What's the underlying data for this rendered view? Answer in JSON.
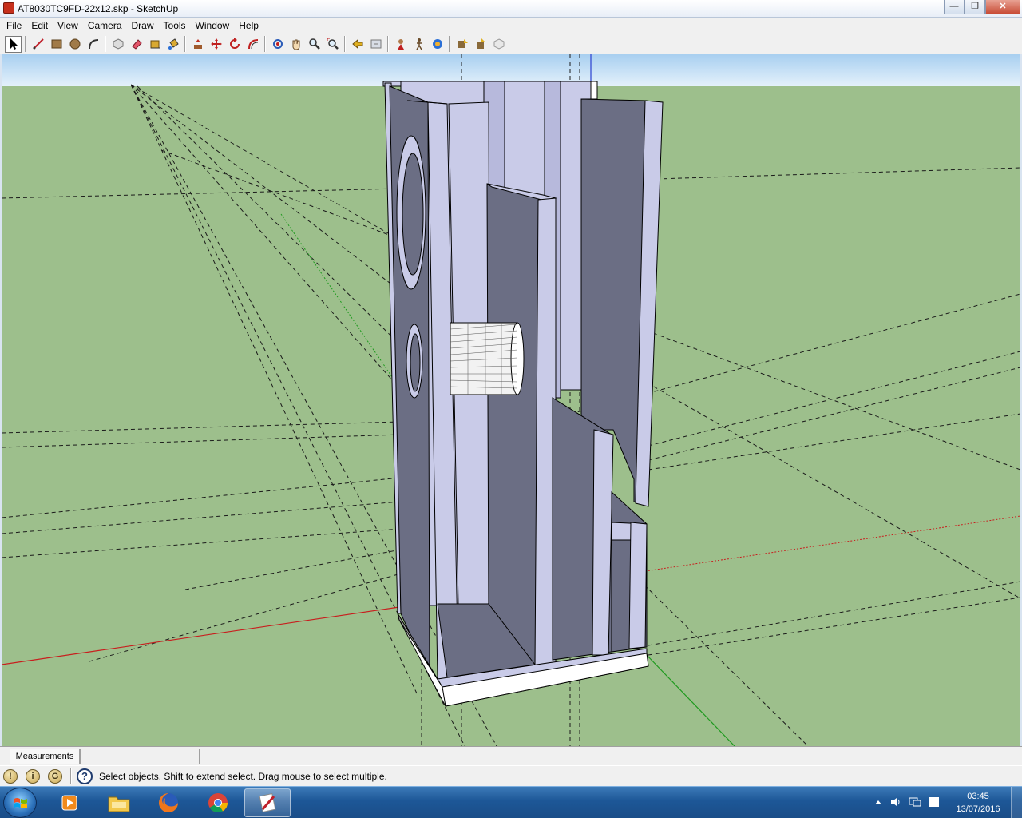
{
  "window": {
    "title": "AT8030TC9FD-22x12.skp - SketchUp",
    "minimize_label": "—",
    "maximize_label": "❐",
    "close_label": "✕"
  },
  "menu": {
    "items": [
      "File",
      "Edit",
      "View",
      "Camera",
      "Draw",
      "Tools",
      "Window",
      "Help"
    ]
  },
  "toolbar": {
    "tools": [
      "select-icon",
      "line-icon",
      "rectangle-icon",
      "circle-icon",
      "arc-icon",
      "make-component-icon",
      "eraser-icon",
      "tape-measure-icon",
      "paint-bucket-icon",
      "push-pull-icon",
      "move-icon",
      "rotate-icon",
      "offset-icon",
      "orbit-icon",
      "pan-icon",
      "zoom-icon",
      "zoom-extents-icon",
      "previous-view-icon",
      "next-view-icon",
      "position-camera-icon",
      "walk-icon",
      "look-around-icon",
      "get-models-icon",
      "share-model-icon",
      "component-share-icon"
    ],
    "active_tool": "select-icon"
  },
  "colors": {
    "ground": "#9dbf8c",
    "sky_top": "#a8cff0",
    "sky_bottom": "#e4f1fb",
    "panel_front": "#6b6e84",
    "panel_light": "#c9cbe8",
    "panel_white": "#ffffff",
    "axis_red": "#c81e1e",
    "axis_green": "#1e9a1e",
    "taskbar": "#1d5797"
  },
  "measurements": {
    "label": "Measurements",
    "value": ""
  },
  "status": {
    "text": "Select objects. Shift to extend select. Drag mouse to select multiple.",
    "geo_icons": [
      "geolocation-icon",
      "credits-icon",
      "signin-icon"
    ],
    "help_label": "?"
  },
  "taskbar": {
    "apps": [
      "media-player-icon",
      "file-explorer-icon",
      "firefox-icon",
      "chrome-icon",
      "sketchup-icon"
    ],
    "active_app": "sketchup-icon",
    "clock_time": "03:45",
    "clock_date": "13/07/2016"
  }
}
